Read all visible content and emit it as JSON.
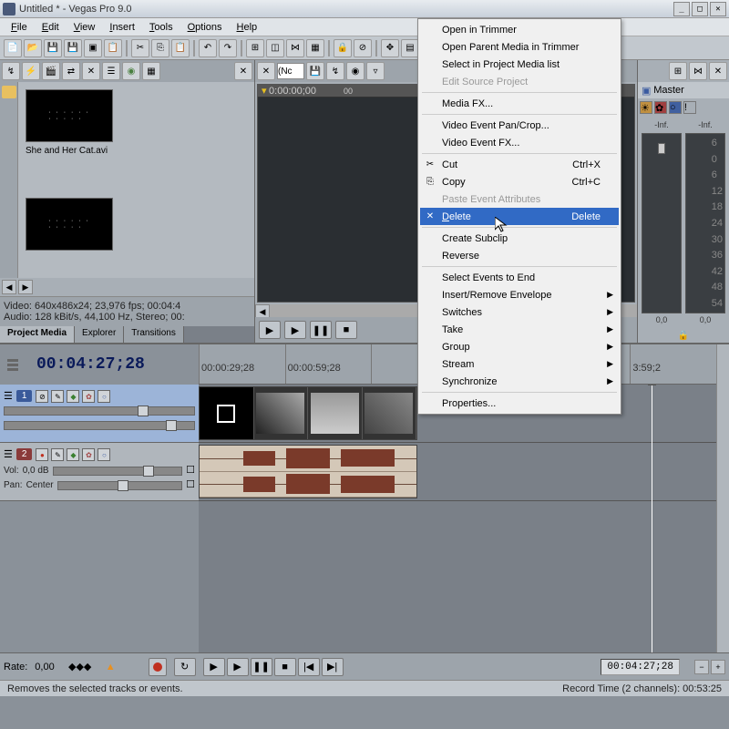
{
  "title": "Untitled * - Vegas Pro 9.0",
  "menubar": [
    "File",
    "Edit",
    "View",
    "Insert",
    "Tools",
    "Options",
    "Help"
  ],
  "context_menu": {
    "items": [
      {
        "label": "Open in Trimmer",
        "type": "item"
      },
      {
        "label": "Open Parent Media in Trimmer",
        "type": "item"
      },
      {
        "label": "Select in Project Media list",
        "type": "item"
      },
      {
        "label": "Edit Source Project",
        "type": "item",
        "disabled": true
      },
      {
        "type": "sep"
      },
      {
        "label": "Media FX...",
        "type": "item"
      },
      {
        "type": "sep"
      },
      {
        "label": "Video Event Pan/Crop...",
        "type": "item"
      },
      {
        "label": "Video Event FX...",
        "type": "item"
      },
      {
        "type": "sep"
      },
      {
        "label": "Cut",
        "type": "item",
        "shortcut": "Ctrl+X",
        "icon": "✂"
      },
      {
        "label": "Copy",
        "type": "item",
        "shortcut": "Ctrl+C",
        "icon": "⎘"
      },
      {
        "label": "Paste Event Attributes",
        "type": "item",
        "disabled": true
      },
      {
        "label": "Delete",
        "type": "item",
        "shortcut": "Delete",
        "icon": "✕",
        "highlighted": true
      },
      {
        "type": "sep"
      },
      {
        "label": "Create Subclip",
        "type": "item"
      },
      {
        "label": "Reverse",
        "type": "item"
      },
      {
        "type": "sep"
      },
      {
        "label": "Select Events to End",
        "type": "item"
      },
      {
        "label": "Insert/Remove Envelope",
        "type": "item",
        "submenu": true
      },
      {
        "label": "Switches",
        "type": "item",
        "submenu": true
      },
      {
        "label": "Take",
        "type": "item",
        "submenu": true
      },
      {
        "label": "Group",
        "type": "item",
        "submenu": true
      },
      {
        "label": "Stream",
        "type": "item",
        "submenu": true
      },
      {
        "label": "Synchronize",
        "type": "item",
        "submenu": true
      },
      {
        "type": "sep"
      },
      {
        "label": "Properties...",
        "type": "item"
      }
    ]
  },
  "project_media": {
    "file_label": "She and Her Cat.avi",
    "info_line1": "Video: 640x486x24; 23,976 fps; 00:04:4",
    "info_line2": "Audio: 128 kBit/s, 44,100 Hz, Stereo; 00:",
    "tabs": [
      "Project Media",
      "Explorer",
      "Transitions"
    ]
  },
  "preview": {
    "input_value": "(Nc",
    "ruler": "0:00:00;00"
  },
  "master": {
    "label": "Master",
    "inf": "-Inf.",
    "scale": [
      "6",
      "0",
      "6",
      "12",
      "18",
      "24",
      "30",
      "36",
      "42",
      "48",
      "54"
    ],
    "value": "0,0"
  },
  "timeline": {
    "timecode": "00:04:27;28",
    "ruler_times": [
      "00:00:29;28",
      "00:00:59;28",
      "",
      "",
      "",
      "3:59;2"
    ],
    "video_track": {
      "num": "1"
    },
    "audio_track": {
      "num": "2",
      "vol_label": "Vol:",
      "vol_value": "0,0 dB",
      "pan_label": "Pan:",
      "pan_value": "Center"
    }
  },
  "bottom": {
    "rate_label": "Rate:",
    "rate_value": "0,00",
    "time": "00:04:27;28"
  },
  "status": {
    "left": "Removes the selected tracks or events.",
    "right": "Record Time (2 channels): 00:53:25"
  }
}
